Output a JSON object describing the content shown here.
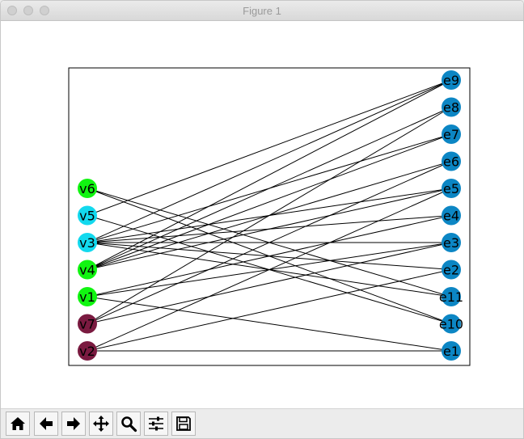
{
  "window": {
    "title": "Figure 1"
  },
  "graph": {
    "left_nodes": [
      {
        "id": "v6",
        "label": "v6",
        "color": "#11f511"
      },
      {
        "id": "v5",
        "label": "v5",
        "color": "#12d9ee"
      },
      {
        "id": "v3",
        "label": "v3",
        "color": "#12d9ee"
      },
      {
        "id": "v4",
        "label": "v4",
        "color": "#11f511"
      },
      {
        "id": "v1",
        "label": "v1",
        "color": "#11f511"
      },
      {
        "id": "v7",
        "label": "v7",
        "color": "#7a1a40"
      },
      {
        "id": "v2",
        "label": "v2",
        "color": "#7a1a40"
      }
    ],
    "right_nodes": [
      {
        "id": "e9",
        "label": "e9",
        "color": "#0c86c4"
      },
      {
        "id": "e8",
        "label": "e8",
        "color": "#0c86c4"
      },
      {
        "id": "e7",
        "label": "e7",
        "color": "#0c86c4"
      },
      {
        "id": "e6",
        "label": "e6",
        "color": "#0c86c4"
      },
      {
        "id": "e5",
        "label": "e5",
        "color": "#0c86c4"
      },
      {
        "id": "e4",
        "label": "e4",
        "color": "#0c86c4"
      },
      {
        "id": "e3",
        "label": "e3",
        "color": "#0c86c4"
      },
      {
        "id": "e2",
        "label": "e2",
        "color": "#0c86c4"
      },
      {
        "id": "e11",
        "label": "e11",
        "color": "#0c86c4"
      },
      {
        "id": "e10",
        "label": "e10",
        "color": "#0c86c4"
      },
      {
        "id": "e1",
        "label": "e1",
        "color": "#0c86c4"
      }
    ],
    "edges": [
      [
        "v6",
        "e11"
      ],
      [
        "v6",
        "e10"
      ],
      [
        "v5",
        "e9"
      ],
      [
        "v5",
        "e10"
      ],
      [
        "v3",
        "e9"
      ],
      [
        "v3",
        "e7"
      ],
      [
        "v3",
        "e5"
      ],
      [
        "v3",
        "e4"
      ],
      [
        "v3",
        "e3"
      ],
      [
        "v3",
        "e2"
      ],
      [
        "v3",
        "e11"
      ],
      [
        "v4",
        "e9"
      ],
      [
        "v4",
        "e8"
      ],
      [
        "v4",
        "e7"
      ],
      [
        "v4",
        "e6"
      ],
      [
        "v4",
        "e5"
      ],
      [
        "v1",
        "e4"
      ],
      [
        "v1",
        "e3"
      ],
      [
        "v1",
        "e1"
      ],
      [
        "v7",
        "e8"
      ],
      [
        "v7",
        "e6"
      ],
      [
        "v7",
        "e3"
      ],
      [
        "v2",
        "e5"
      ],
      [
        "v2",
        "e2"
      ],
      [
        "v2",
        "e1"
      ]
    ]
  },
  "toolbar": {
    "buttons": [
      {
        "name": "home-button",
        "icon": "home-icon"
      },
      {
        "name": "back-button",
        "icon": "arrow-left-icon"
      },
      {
        "name": "forward-button",
        "icon": "arrow-right-icon"
      },
      {
        "name": "pan-button",
        "icon": "move-icon"
      },
      {
        "name": "zoom-button",
        "icon": "magnifier-icon"
      },
      {
        "name": "configure-subplots-button",
        "icon": "sliders-icon"
      },
      {
        "name": "save-button",
        "icon": "floppy-disk-icon"
      }
    ]
  }
}
